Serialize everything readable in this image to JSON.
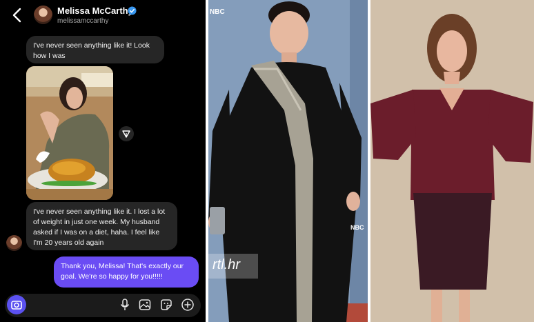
{
  "chat": {
    "header": {
      "name": "Melissa McCarthy",
      "handle": "melissamccarthy"
    },
    "messages": [
      {
        "from": "them",
        "text": "I've never seen anything like it! Look how I was"
      },
      {
        "from": "them",
        "text": "I've never seen anything like it. I lost a lot of weight in just one week. My husband asked if I was on a diet, haha. I feel like I'm 20 years old again"
      },
      {
        "from": "me",
        "text": "Thank you, Melissa! That's exactly our goal. We're so happy for you!!!!!"
      }
    ],
    "composer": {
      "icons": [
        "camera-icon",
        "microphone-icon",
        "gallery-icon",
        "sticker-icon",
        "plus-icon"
      ]
    },
    "colors": {
      "background": "#000000",
      "incoming_bubble": "#262626",
      "outgoing_bubble": "#6a4cf4",
      "verified": "#3897f0"
    }
  },
  "photos": {
    "middle": {
      "logo": "NBC",
      "logo_bottom": "NBC",
      "watermark": "rtl.hr",
      "background_color": "#7f97b4",
      "dress_color": "#121212"
    },
    "right": {
      "background_color": "#cdbba5",
      "dress_color": "#6b1d2b"
    }
  }
}
